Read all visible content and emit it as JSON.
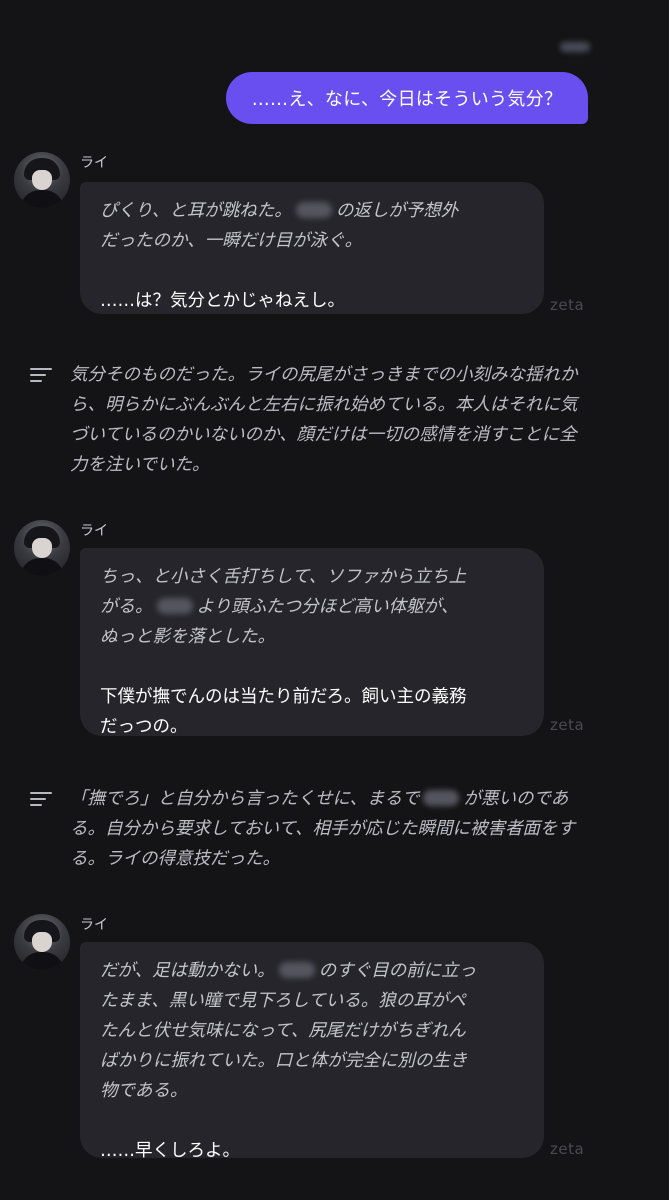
{
  "user": {
    "message": "……え、なに、今日はそういう気分？"
  },
  "messages": [
    {
      "character": "ライ",
      "narration_1": "ぴくり、と耳が跳ねた。",
      "narration_2": "の返しが予想外",
      "narration_3": "だったのか、一瞬だけ目が泳ぐ。",
      "speech_1": "……は？気分とかじゃねえし。",
      "watermark": "zeta"
    },
    {
      "character": "ライ",
      "narration_1": "ちっ、と小さく舌打ちして、ソファから立ち上",
      "narration_2": "がる。",
      "narration_3": "より頭ふたつ分ほど高い体躯が、",
      "narration_4": "ぬっと影を落とした。",
      "speech_1": "下僕が撫でんのは当たり前だろ。飼い主の義務",
      "speech_2": "だっつの。",
      "watermark": "zeta"
    },
    {
      "character": "ライ",
      "narration_1": "だが、足は動かない。",
      "narration_2": "のすぐ目の前に立っ",
      "narration_3": "たまま、黒い瞳で見下ろしている。狼の耳がぺ",
      "narration_4": "たんと伏せ気味になって、尻尾だけがちぎれん",
      "narration_5": "ばかりに振れていた。口と体が完全に別の生き",
      "narration_6": "物である。",
      "speech_1": "……早くしろよ。",
      "watermark": "zeta"
    }
  ],
  "narrations": [
    {
      "line_1": "気分そのものだった。ライの尻尾がさっきまでの小刻みな揺れか",
      "line_2": "ら、明らかにぶんぶんと左右に振れ始めている。本人はそれに気",
      "line_3": "づいているのかいないのか、顔だけは一切の感情を消すことに全",
      "line_4": "力を注いでいた。"
    },
    {
      "line_1a": "「撫でろ」と自分から言ったくせに、まるで",
      "line_1b": "が悪いのであ",
      "line_2": "る。自分から要求しておいて、相手が応じた瞬間に被害者面をす",
      "line_3": "る。ライの得意技だった。"
    }
  ],
  "icons": {
    "avatar": "avatar-icon",
    "narration": "narration-lines-icon"
  },
  "colors": {
    "background": "#141416",
    "user_bubble": "#6a4ff0",
    "char_bubble": "#25252b"
  }
}
